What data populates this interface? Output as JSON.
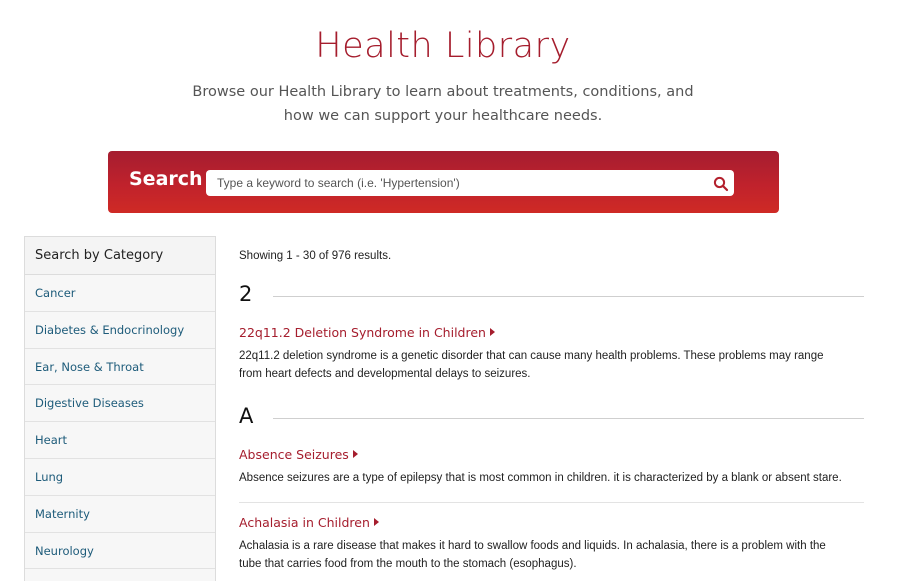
{
  "hero": {
    "title": "Health Library",
    "subtitle": "Browse our Health Library to learn about treatments, conditions, and how we can support your healthcare needs."
  },
  "search": {
    "label": "Search",
    "placeholder": "Type a keyword to search (i.e. 'Hypertension')",
    "value": "",
    "icon": "search-icon"
  },
  "sidebar": {
    "heading": "Search by Category",
    "items": [
      {
        "label": "Cancer"
      },
      {
        "label": "Diabetes & Endocrinology"
      },
      {
        "label": "Ear, Nose & Throat"
      },
      {
        "label": "Digestive Diseases"
      },
      {
        "label": "Heart"
      },
      {
        "label": "Lung"
      },
      {
        "label": "Maternity"
      },
      {
        "label": "Neurology"
      }
    ]
  },
  "results": {
    "count_text": "Showing 1 - 30 of 976 results.",
    "groups": [
      {
        "letter": "2",
        "entries": [
          {
            "title": "22q11.2 Deletion Syndrome in Children",
            "description": "22q11.2 deletion syndrome is a genetic disorder that can cause many health problems. These problems may range from heart defects and developmental delays to seizures."
          }
        ]
      },
      {
        "letter": "A",
        "entries": [
          {
            "title": "Absence Seizures",
            "description": "Absence seizures are a type of epilepsy that is most common in children. it is characterized by a blank or absent stare."
          },
          {
            "title": "Achalasia in Children",
            "description": "Achalasia is a rare disease that makes it hard to swallow foods and liquids. In achalasia, there is a problem with the tube that carries food from the mouth to the stomach (esophagus)."
          }
        ]
      }
    ]
  },
  "colors": {
    "brand": "#a51d2d",
    "search_gradient_top": "#a51d30",
    "search_gradient_bottom": "#cf2a25",
    "category_link": "#1d5b7a"
  }
}
